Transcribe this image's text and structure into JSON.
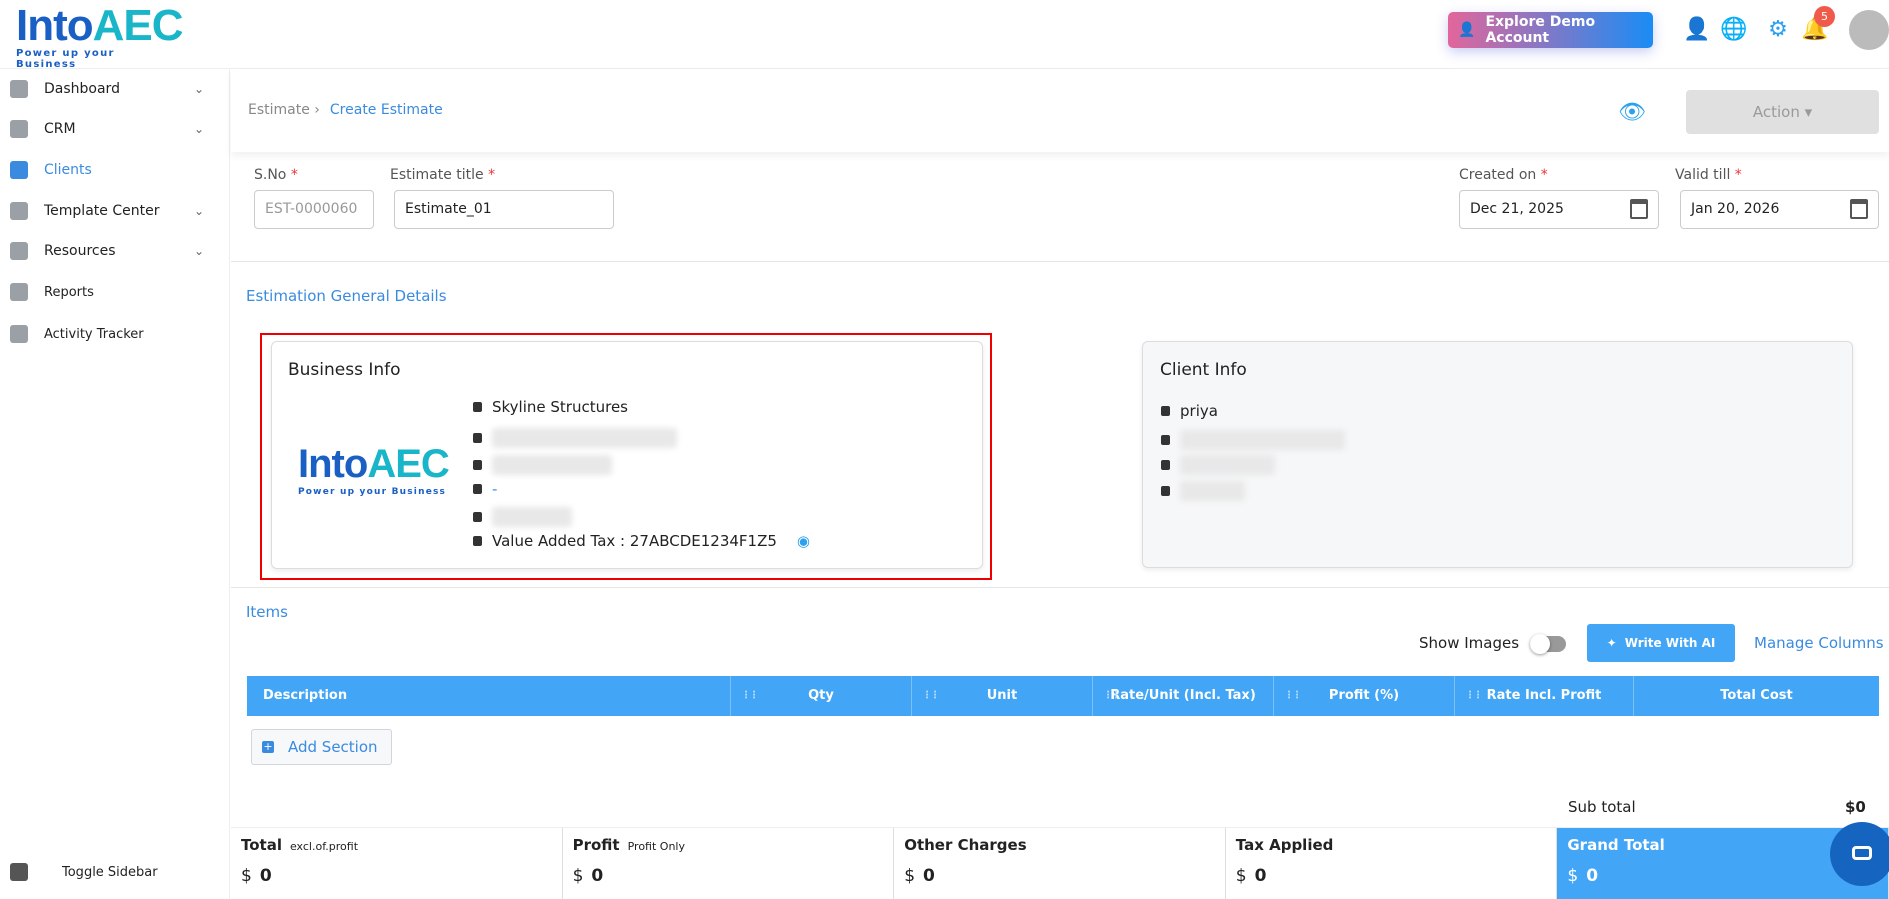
{
  "logo": {
    "name": "Into",
    "accent": "AEC",
    "tagline": "Power up your Business"
  },
  "topbar": {
    "demo_label": "Explore Demo Account",
    "notifications": "5"
  },
  "sidebar": {
    "items": [
      {
        "label": "Dashboard"
      },
      {
        "label": "CRM"
      },
      {
        "label": "Clients"
      },
      {
        "label": "Template Center"
      },
      {
        "label": "Resources"
      },
      {
        "label": "Reports"
      },
      {
        "label": "Activity Tracker"
      }
    ],
    "toggle": "Toggle Sidebar"
  },
  "breadcrumb": {
    "parent": "Estimate",
    "current": "Create Estimate"
  },
  "action_label": "Action",
  "form": {
    "sno_label": "S.No",
    "sno_value": "EST-0000060",
    "title_label": "Estimate title",
    "title_value": "Estimate_01",
    "created_label": "Created on",
    "created_value": "Dec 21, 2025",
    "valid_label": "Valid till",
    "valid_value": "Jan 20, 2026",
    "required": "*"
  },
  "general_title": "Estimation General Details",
  "business": {
    "title": "Business Info",
    "name": "Skyline Structures",
    "website": "-",
    "vat": "Value Added Tax : 27ABCDE1234F1Z5"
  },
  "client": {
    "title": "Client Info",
    "name": "priya"
  },
  "items": {
    "title": "Items",
    "show_images": "Show Images",
    "write_ai": "Write With AI",
    "manage_columns": "Manage Columns",
    "columns": [
      "Description",
      "Qty",
      "Unit",
      "Rate/Unit (Incl. Tax)",
      "Profit (%)",
      "Rate Incl. Profit",
      "Total Cost"
    ],
    "add_section": "Add Section",
    "subtotal_label": "Sub total",
    "subtotal_value": "$0"
  },
  "footer": [
    {
      "label": "Total",
      "sub": "excl.of.profit",
      "currency": "$",
      "value": "0"
    },
    {
      "label": "Profit",
      "sub": "Profit Only",
      "currency": "$",
      "value": "0"
    },
    {
      "label": "Other Charges",
      "currency": "$",
      "value": "0"
    },
    {
      "label": "Tax Applied",
      "currency": "$",
      "value": "0"
    },
    {
      "label": "Grand Total",
      "currency": "$",
      "value": "0"
    }
  ]
}
